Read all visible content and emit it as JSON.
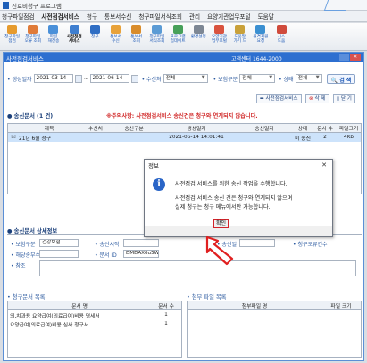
{
  "app": {
    "title": "진료비청구 프로그램"
  },
  "menu": [
    "청구파일점검",
    "사전점검서비스",
    "청구",
    "통보서수신",
    "청구파일서식조회",
    "관리",
    "요양기관업무포털",
    "도움말"
  ],
  "toolbar": [
    {
      "label": "청구파일\n점검",
      "icon": "check-file-icon",
      "color": "#e69b2e"
    },
    {
      "label": "청구파일\n오류 조회",
      "icon": "error-search-icon",
      "color": "#e07b39"
    },
    {
      "label": "파일\n재전송",
      "icon": "resend-icon",
      "color": "#4a90d9"
    },
    {
      "label": "사전점검\n서비스",
      "icon": "precheck-icon",
      "color": "#3f7fd0",
      "active": true
    },
    {
      "label": "청구",
      "icon": "claim-icon",
      "color": "#2f6ec4"
    },
    {
      "label": "통보서\n수신",
      "icon": "receive-icon",
      "color": "#e8a23a"
    },
    {
      "label": "통보서\n조회",
      "icon": "notice-view-icon",
      "color": "#d98c2b"
    },
    {
      "label": "청구파일\n서식조회",
      "icon": "form-view-icon",
      "color": "#5b9bd5"
    },
    {
      "label": "프로그램\n업데이트",
      "icon": "update-icon",
      "color": "#47a05a"
    },
    {
      "label": "환경설정",
      "icon": "settings-icon",
      "color": "#7d8794"
    },
    {
      "label": "요양기관\n업무포털",
      "icon": "portal-icon",
      "color": "#d9533f"
    },
    {
      "label": "도움말\n가기 드",
      "icon": "help-icon",
      "color": "#c9a13a"
    },
    {
      "label": "원격지원\n요청",
      "icon": "remote-icon",
      "color": "#3a8fd1"
    },
    {
      "label": "시스\n도움",
      "icon": "system-help-icon",
      "color": "#d04b3c"
    }
  ],
  "window": {
    "title": "사전점검서비스",
    "callcenter": "고객센터 1644-2000"
  },
  "search": {
    "date_label": "• 생성일자",
    "date_from": "2021-03-14",
    "date_to": "2021-06-14",
    "tilde": "~",
    "receiver_label": "• 수신처",
    "receiver_value": "전체",
    "insurance_label": "• 보험구분",
    "insurance_value": "전체",
    "status_label": "• 상태",
    "status_value": "전체",
    "search_button": "검 색"
  },
  "buttons": {
    "precheck": "사전점검서비스",
    "delete": "삭 제",
    "close": "닫 기"
  },
  "send_docs": {
    "section_title": "● 송신문서 (1 건)",
    "notice": "※주의사항: 사전점검서비스 송신건은 청구와 연계되지 않습니다.",
    "headers": [
      "",
      "제목",
      "수신처",
      "송신구분",
      "생성일자",
      "송신일자",
      "상태",
      "문서 수",
      "파일크기"
    ],
    "rows": [
      [
        "☑",
        "21년 6월 청구",
        "",
        "",
        "2021-06-14 14:01:41",
        "",
        "미 송신",
        "2",
        "4Kb"
      ]
    ]
  },
  "detail": {
    "section_title": "● 송신문서 상세정보",
    "insurance_label": "• 보험구분",
    "insurance_value": "건강보험",
    "start_label": "• 송신시작",
    "send_label": "• 송신일",
    "claim_count_label": "• 청구오류건수",
    "doc_no_label": "• 해당송부수",
    "doc_id_label": "• 문서 ID",
    "doc_id_value": "DMDAX6u5W8A",
    "ref_label": "• 참조"
  },
  "claim_docs": {
    "section_title": "• 청구문서 목록",
    "headers": [
      "문서 명",
      "문서 수"
    ],
    "rows": [
      [
        "의,치과용 요양급여(의료급여)비용 명세서",
        "1"
      ],
      [
        "요양급여(의료급여)비용 심사 청구서",
        "1"
      ]
    ]
  },
  "attach_files": {
    "section_title": "• 첨부 파일 목록",
    "headers": [
      "첨부파일 명",
      "파일 크기"
    ]
  },
  "dialog": {
    "title": "정보",
    "line1": "사전점검 서비스를 위한 송신 작업을 수행합니다.",
    "line2": "사전점검 서비스 송신 건은 청구와 연계되지 않으며",
    "line3": "실제 청구는 청구 메뉴에서만 가능합니다.",
    "ok": "확인"
  }
}
